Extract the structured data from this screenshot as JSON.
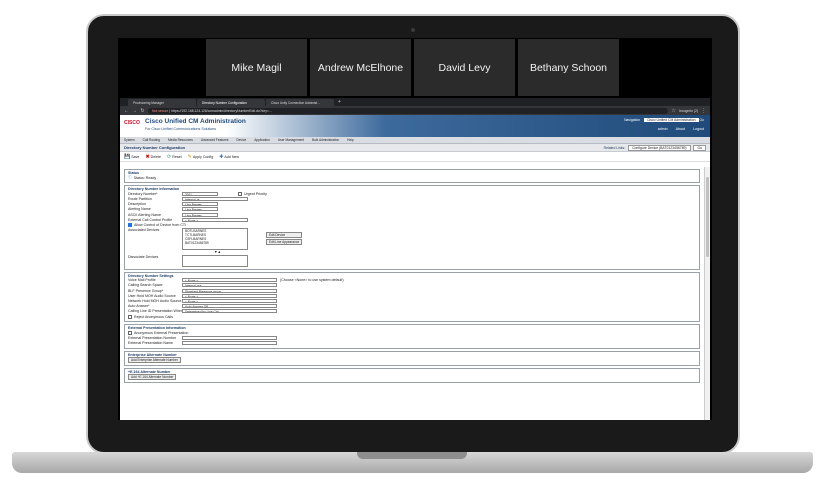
{
  "meeting": {
    "participants": [
      "Mike Magil",
      "Andrew McElhone",
      "David Levy",
      "Bethany Schoon"
    ]
  },
  "browser": {
    "tabs": [
      "Provisioning Manager",
      "Directory Number Configuration",
      "Cisco Unity Connection Administ..."
    ],
    "url_warning": "Not secure",
    "url": "https://192.168.124.126/ccmadmin/directoryNumberEdit.do?key=...",
    "profile": "Incognito (2)"
  },
  "app": {
    "logo": "CISCO",
    "title": "Cisco Unified CM Administration",
    "subtitle": "For Cisco Unified Communications Solutions",
    "navigation_label": "Navigation",
    "navigation_value": "Cisco Unified CM Administration",
    "user": "admin",
    "links": [
      "admin",
      "About",
      "Logout"
    ],
    "menu": [
      "System",
      "Call Routing",
      "Media Resources",
      "Advanced Features",
      "Device",
      "Application",
      "User Management",
      "Bulk Administration",
      "Help"
    ]
  },
  "page": {
    "title": "Directory Number Configuration",
    "related_links_label": "Related Links:",
    "related_links_value": "Configure Device (BAT0123456789)",
    "go_label": "Go",
    "toolbar": [
      "Save",
      "Delete",
      "Reset",
      "Apply Config",
      "Add New"
    ]
  },
  "status": {
    "legend": "Status",
    "text": "Status: Ready"
  },
  "dn_info": {
    "legend": "Directory Number Information",
    "fields": [
      {
        "label": "Directory Number*",
        "value": "3011"
      },
      {
        "label": "Route Partition",
        "value": "Internal-pt"
      },
      {
        "label": "Description",
        "value": "Lisa Barnes"
      },
      {
        "label": "Alerting Name",
        "value": "Lisa Barnes"
      },
      {
        "label": "ASCII Alerting Name",
        "value": "Lisa Barnes"
      },
      {
        "label": "External Call Control Profile",
        "value": "< None >"
      }
    ],
    "urgent_priority": "Urgent Priority",
    "allow_control": "Allow Control of Device from CTI",
    "associated_devices_label": "Associated Devices",
    "associated_devices": [
      "BOTLBARNES",
      "TCTLBARNES",
      "CSFLBARNES",
      "BAT0123456789"
    ],
    "edit_device": "Edit Device",
    "edit_line_appearance": "Edit Line Appearance",
    "arrows": "▼▲",
    "dissociate_label": "Dissociate Devices"
  },
  "dn_settings": {
    "legend": "Directory Number Settings",
    "fields": [
      {
        "label": "Voice Mail Profile",
        "value": "< None >",
        "note": "(Choose <None> to use system default)"
      },
      {
        "label": "Calling Search Space",
        "value": "Internal-css",
        "note": ""
      },
      {
        "label": "BLF Presence Group*",
        "value": "Standard Presence group",
        "note": ""
      },
      {
        "label": "User Hold MOH Audio Source",
        "value": "< None >",
        "note": ""
      },
      {
        "label": "Network Hold MOH Audio Source",
        "value": "< None >",
        "note": ""
      },
      {
        "label": "Auto Answer*",
        "value": "Auto Answer Off",
        "note": ""
      },
      {
        "label": "Calling Line ID Presentation When Diverted",
        "value": "Determined by Line Ctrl",
        "note": ""
      }
    ],
    "reject_anonymous": "Reject Anonymous Calls"
  },
  "ext_presentation": {
    "legend": "External Presentation Information",
    "anonymous": "Anonymous External Presentation",
    "number_label": "External Presentation Number",
    "name_label": "External Presentation Name"
  },
  "enterprise_alt": {
    "legend": "Enterprise Alternate Number",
    "button": "Add Enterprise Alternate Number"
  },
  "e164_alt": {
    "legend": "+E.164 Alternate Number",
    "button": "Add +E.164 Alternate Number"
  }
}
